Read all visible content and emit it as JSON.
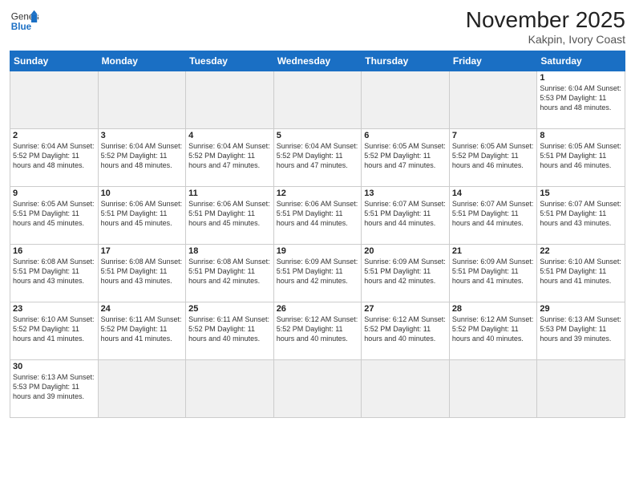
{
  "header": {
    "logo_general": "General",
    "logo_blue": "Blue",
    "month": "November 2025",
    "location": "Kakpin, Ivory Coast"
  },
  "weekdays": [
    "Sunday",
    "Monday",
    "Tuesday",
    "Wednesday",
    "Thursday",
    "Friday",
    "Saturday"
  ],
  "days": [
    {
      "num": "",
      "info": "",
      "empty": true
    },
    {
      "num": "",
      "info": "",
      "empty": true
    },
    {
      "num": "",
      "info": "",
      "empty": true
    },
    {
      "num": "",
      "info": "",
      "empty": true
    },
    {
      "num": "",
      "info": "",
      "empty": true
    },
    {
      "num": "",
      "info": "",
      "empty": true
    },
    {
      "num": "1",
      "info": "Sunrise: 6:04 AM\nSunset: 5:53 PM\nDaylight: 11 hours\nand 48 minutes.",
      "empty": false
    },
    {
      "num": "2",
      "info": "Sunrise: 6:04 AM\nSunset: 5:52 PM\nDaylight: 11 hours\nand 48 minutes.",
      "empty": false
    },
    {
      "num": "3",
      "info": "Sunrise: 6:04 AM\nSunset: 5:52 PM\nDaylight: 11 hours\nand 48 minutes.",
      "empty": false
    },
    {
      "num": "4",
      "info": "Sunrise: 6:04 AM\nSunset: 5:52 PM\nDaylight: 11 hours\nand 47 minutes.",
      "empty": false
    },
    {
      "num": "5",
      "info": "Sunrise: 6:04 AM\nSunset: 5:52 PM\nDaylight: 11 hours\nand 47 minutes.",
      "empty": false
    },
    {
      "num": "6",
      "info": "Sunrise: 6:05 AM\nSunset: 5:52 PM\nDaylight: 11 hours\nand 47 minutes.",
      "empty": false
    },
    {
      "num": "7",
      "info": "Sunrise: 6:05 AM\nSunset: 5:52 PM\nDaylight: 11 hours\nand 46 minutes.",
      "empty": false
    },
    {
      "num": "8",
      "info": "Sunrise: 6:05 AM\nSunset: 5:51 PM\nDaylight: 11 hours\nand 46 minutes.",
      "empty": false
    },
    {
      "num": "9",
      "info": "Sunrise: 6:05 AM\nSunset: 5:51 PM\nDaylight: 11 hours\nand 45 minutes.",
      "empty": false
    },
    {
      "num": "10",
      "info": "Sunrise: 6:06 AM\nSunset: 5:51 PM\nDaylight: 11 hours\nand 45 minutes.",
      "empty": false
    },
    {
      "num": "11",
      "info": "Sunrise: 6:06 AM\nSunset: 5:51 PM\nDaylight: 11 hours\nand 45 minutes.",
      "empty": false
    },
    {
      "num": "12",
      "info": "Sunrise: 6:06 AM\nSunset: 5:51 PM\nDaylight: 11 hours\nand 44 minutes.",
      "empty": false
    },
    {
      "num": "13",
      "info": "Sunrise: 6:07 AM\nSunset: 5:51 PM\nDaylight: 11 hours\nand 44 minutes.",
      "empty": false
    },
    {
      "num": "14",
      "info": "Sunrise: 6:07 AM\nSunset: 5:51 PM\nDaylight: 11 hours\nand 44 minutes.",
      "empty": false
    },
    {
      "num": "15",
      "info": "Sunrise: 6:07 AM\nSunset: 5:51 PM\nDaylight: 11 hours\nand 43 minutes.",
      "empty": false
    },
    {
      "num": "16",
      "info": "Sunrise: 6:08 AM\nSunset: 5:51 PM\nDaylight: 11 hours\nand 43 minutes.",
      "empty": false
    },
    {
      "num": "17",
      "info": "Sunrise: 6:08 AM\nSunset: 5:51 PM\nDaylight: 11 hours\nand 43 minutes.",
      "empty": false
    },
    {
      "num": "18",
      "info": "Sunrise: 6:08 AM\nSunset: 5:51 PM\nDaylight: 11 hours\nand 42 minutes.",
      "empty": false
    },
    {
      "num": "19",
      "info": "Sunrise: 6:09 AM\nSunset: 5:51 PM\nDaylight: 11 hours\nand 42 minutes.",
      "empty": false
    },
    {
      "num": "20",
      "info": "Sunrise: 6:09 AM\nSunset: 5:51 PM\nDaylight: 11 hours\nand 42 minutes.",
      "empty": false
    },
    {
      "num": "21",
      "info": "Sunrise: 6:09 AM\nSunset: 5:51 PM\nDaylight: 11 hours\nand 41 minutes.",
      "empty": false
    },
    {
      "num": "22",
      "info": "Sunrise: 6:10 AM\nSunset: 5:51 PM\nDaylight: 11 hours\nand 41 minutes.",
      "empty": false
    },
    {
      "num": "23",
      "info": "Sunrise: 6:10 AM\nSunset: 5:52 PM\nDaylight: 11 hours\nand 41 minutes.",
      "empty": false
    },
    {
      "num": "24",
      "info": "Sunrise: 6:11 AM\nSunset: 5:52 PM\nDaylight: 11 hours\nand 41 minutes.",
      "empty": false
    },
    {
      "num": "25",
      "info": "Sunrise: 6:11 AM\nSunset: 5:52 PM\nDaylight: 11 hours\nand 40 minutes.",
      "empty": false
    },
    {
      "num": "26",
      "info": "Sunrise: 6:12 AM\nSunset: 5:52 PM\nDaylight: 11 hours\nand 40 minutes.",
      "empty": false
    },
    {
      "num": "27",
      "info": "Sunrise: 6:12 AM\nSunset: 5:52 PM\nDaylight: 11 hours\nand 40 minutes.",
      "empty": false
    },
    {
      "num": "28",
      "info": "Sunrise: 6:12 AM\nSunset: 5:52 PM\nDaylight: 11 hours\nand 40 minutes.",
      "empty": false
    },
    {
      "num": "29",
      "info": "Sunrise: 6:13 AM\nSunset: 5:53 PM\nDaylight: 11 hours\nand 39 minutes.",
      "empty": false
    },
    {
      "num": "30",
      "info": "Sunrise: 6:13 AM\nSunset: 5:53 PM\nDaylight: 11 hours\nand 39 minutes.",
      "empty": false
    },
    {
      "num": "",
      "info": "",
      "empty": true
    },
    {
      "num": "",
      "info": "",
      "empty": true
    },
    {
      "num": "",
      "info": "",
      "empty": true
    },
    {
      "num": "",
      "info": "",
      "empty": true
    },
    {
      "num": "",
      "info": "",
      "empty": true
    },
    {
      "num": "",
      "info": "",
      "empty": true
    }
  ]
}
